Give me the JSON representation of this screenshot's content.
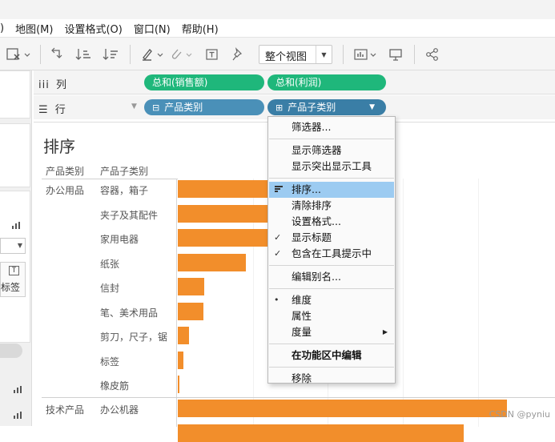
{
  "menubar": [
    ")",
    "地图(M)",
    "设置格式(O)",
    "窗口(N)",
    "帮助(H)"
  ],
  "toolbar": {
    "view_mode": "整个视图"
  },
  "shelves": {
    "columns_label": "列",
    "columns_icon": "iii",
    "rows_label": "行",
    "rows_icon": "☰",
    "column_pills": [
      "总和(销售额)",
      "总和(利润)"
    ],
    "row_pills": [
      "产品类别",
      "产品子类别"
    ]
  },
  "left_panel": {
    "label_text": "标签",
    "label_icon_glyph": "T"
  },
  "sheet": {
    "title": "排序",
    "header_category": "产品类别",
    "header_subcategory": "产品子类别",
    "categories": [
      "办公用品",
      "技术产品"
    ]
  },
  "chart_data": {
    "type": "bar",
    "orientation": "horizontal",
    "color": "#f28e2b",
    "categories": [
      "容器，箱子",
      "夹子及其配件",
      "家用电器",
      "纸张",
      "信封",
      "笔、美术用品",
      "剪刀，尺子，锯",
      "标签",
      "橡皮筋",
      "办公机器",
      ""
    ],
    "values": [
      null,
      null,
      null,
      85,
      33,
      32,
      14,
      7,
      2,
      411,
      357
    ],
    "groups": [
      {
        "name": "办公用品",
        "members": [
          "容器，箱子",
          "夹子及其配件",
          "家用电器",
          "纸张",
          "信封",
          "笔、美术用品",
          "剪刀，尺子，锯",
          "标签",
          "橡皮筋"
        ]
      },
      {
        "name": "技术产品",
        "members": [
          "办公机器",
          ""
        ]
      }
    ],
    "xlim": [
      0,
      411
    ],
    "series": [
      {
        "values": [
          null,
          null,
          null,
          85,
          33,
          32,
          14,
          7,
          2,
          411,
          357
        ]
      }
    ]
  },
  "context_menu": {
    "items": [
      {
        "label": "筛选器...",
        "checked": false,
        "bullet": false,
        "submenu": false,
        "highlight": false,
        "bold": false
      },
      {
        "sep": true
      },
      {
        "label": "显示筛选器",
        "checked": false,
        "bullet": false,
        "submenu": false,
        "highlight": false,
        "bold": false
      },
      {
        "label": "显示突出显示工具",
        "checked": false,
        "bullet": false,
        "submenu": false,
        "highlight": false,
        "bold": false
      },
      {
        "sep": true
      },
      {
        "label": "排序...",
        "icon": "sort-icon",
        "checked": false,
        "bullet": false,
        "submenu": false,
        "highlight": true,
        "bold": false
      },
      {
        "label": "清除排序",
        "checked": false,
        "bullet": false,
        "submenu": false,
        "highlight": false,
        "bold": false
      },
      {
        "label": "设置格式...",
        "checked": false,
        "bullet": false,
        "submenu": false,
        "highlight": false,
        "bold": false
      },
      {
        "label": "显示标题",
        "checked": true,
        "bullet": false,
        "submenu": false,
        "highlight": false,
        "bold": false
      },
      {
        "label": "包含在工具提示中",
        "checked": true,
        "bullet": false,
        "submenu": false,
        "highlight": false,
        "bold": false
      },
      {
        "sep": true
      },
      {
        "label": "编辑别名...",
        "checked": false,
        "bullet": false,
        "submenu": false,
        "highlight": false,
        "bold": false
      },
      {
        "sep": true
      },
      {
        "label": "维度",
        "checked": false,
        "bullet": true,
        "submenu": false,
        "highlight": false,
        "bold": false
      },
      {
        "label": "属性",
        "checked": false,
        "bullet": false,
        "submenu": false,
        "highlight": false,
        "bold": false
      },
      {
        "label": "度量",
        "checked": false,
        "bullet": false,
        "submenu": true,
        "highlight": false,
        "bold": false
      },
      {
        "sep": true
      },
      {
        "label": "在功能区中编辑",
        "checked": false,
        "bullet": false,
        "submenu": false,
        "highlight": false,
        "bold": true
      },
      {
        "sep": true
      },
      {
        "label": "移除",
        "checked": false,
        "bullet": false,
        "submenu": false,
        "highlight": false,
        "bold": false
      }
    ]
  },
  "watermark": "CSDN @pyniu"
}
